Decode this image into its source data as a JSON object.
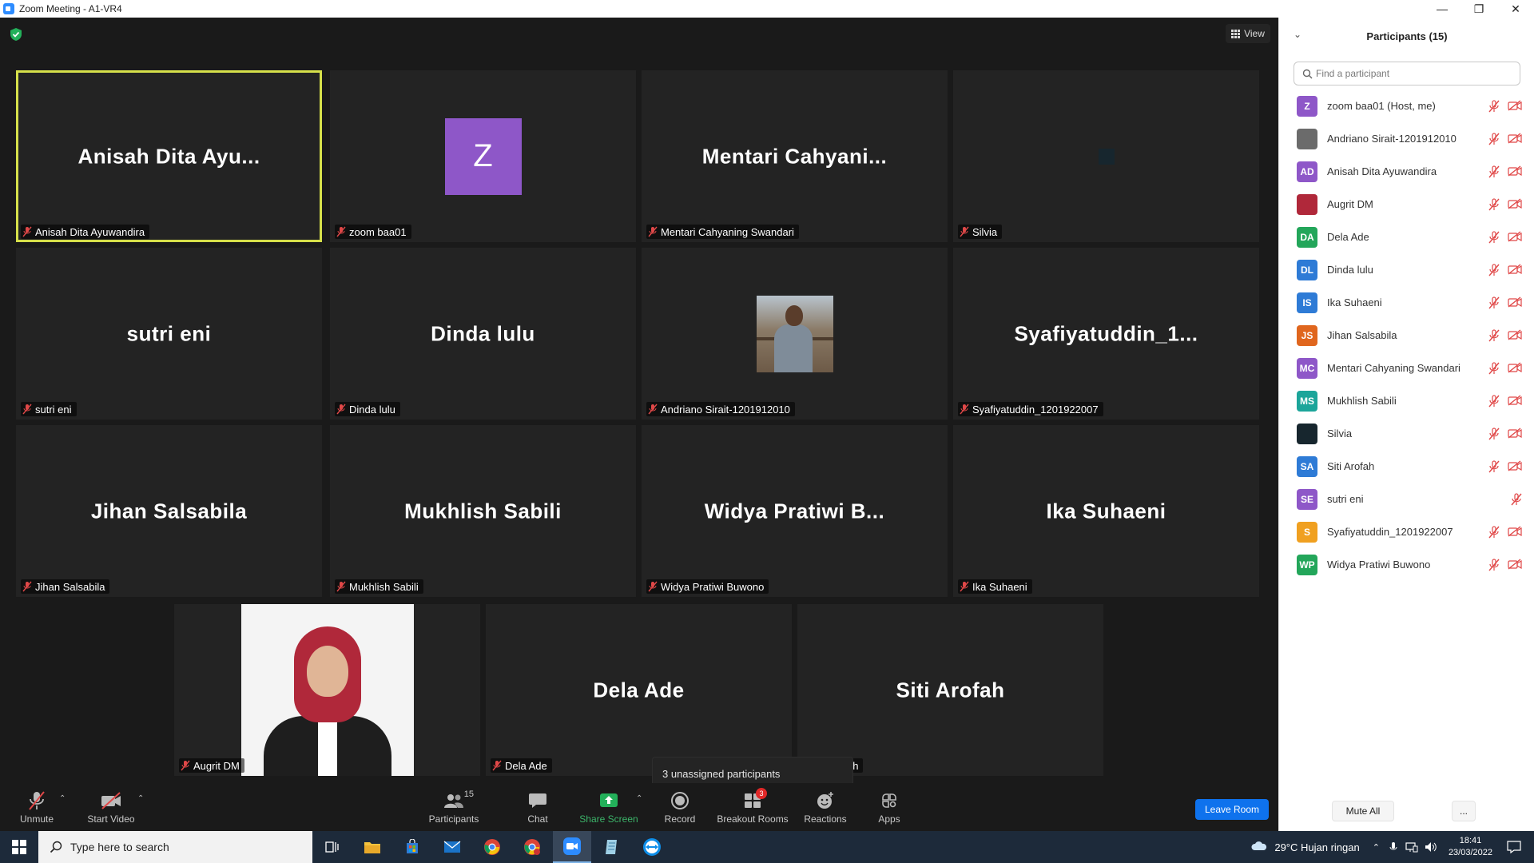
{
  "window": {
    "title": "Zoom Meeting - A1-VR4",
    "minimize": "—",
    "restore": "❐",
    "close": "✕"
  },
  "meeting": {
    "view_label": "View",
    "tiles": [
      {
        "big": "Anisah  Dita  Ayu...",
        "tag": "Anisah Dita Ayuwandira"
      },
      {
        "big": "Z",
        "tag": "zoom baa01"
      },
      {
        "big": "Mentari  Cahyani...",
        "tag": "Mentari Cahyaning Swandari"
      },
      {
        "big": "",
        "tag": "Silvia"
      },
      {
        "big": "sutri eni",
        "tag": "sutri eni"
      },
      {
        "big": "Dinda lulu",
        "tag": "Dinda lulu"
      },
      {
        "big": "",
        "tag": "Andriano Sirait-1201912010"
      },
      {
        "big": "Syafiyatuddin_1...",
        "tag": "Syafiyatuddin_1201922007"
      },
      {
        "big": "Jihan Salsabila",
        "tag": "Jihan Salsabila"
      },
      {
        "big": "Mukhlish Sabili",
        "tag": "Mukhlish Sabili"
      },
      {
        "big": "Widya  Pratiwi  B...",
        "tag": "Widya Pratiwi Buwono"
      },
      {
        "big": "Ika Suhaeni",
        "tag": "Ika Suhaeni"
      },
      {
        "big": "",
        "tag": "Augrit DM"
      },
      {
        "big": "Dela Ade",
        "tag": "Dela Ade"
      },
      {
        "big": "Siti Arofah",
        "tag": "ah"
      }
    ],
    "unassigned_tooltip": "3 unassigned participants"
  },
  "toolbar": {
    "unmute": "Unmute",
    "start_video": "Start Video",
    "participants": "Participants",
    "participants_count": "15",
    "chat": "Chat",
    "share_screen": "Share Screen",
    "record": "Record",
    "breakout_rooms": "Breakout Rooms",
    "breakout_badge": "3",
    "reactions": "Reactions",
    "apps": "Apps",
    "leave_room": "Leave Room"
  },
  "panel": {
    "title": "Participants (15)",
    "search_placeholder": "Find a participant",
    "participants": [
      {
        "initials": "Z",
        "name": "zoom baa01 (Host, me)",
        "color": "#8e57c8"
      },
      {
        "initials": "",
        "name": "Andriano Sirait-1201912010",
        "color": "#6b6b6b"
      },
      {
        "initials": "AD",
        "name": "Anisah Dita Ayuwandira",
        "color": "#8e57c8"
      },
      {
        "initials": "",
        "name": "Augrit DM",
        "color": "#b0283a"
      },
      {
        "initials": "DA",
        "name": "Dela Ade",
        "color": "#23a65a"
      },
      {
        "initials": "DL",
        "name": "Dinda lulu",
        "color": "#2e7bd6"
      },
      {
        "initials": "IS",
        "name": "Ika Suhaeni",
        "color": "#2e7bd6"
      },
      {
        "initials": "JS",
        "name": "Jihan Salsabila",
        "color": "#e0661e"
      },
      {
        "initials": "MC",
        "name": "Mentari Cahyaning Swandari",
        "color": "#8e57c8"
      },
      {
        "initials": "MS",
        "name": "Mukhlish Sabili",
        "color": "#1ca59a"
      },
      {
        "initials": "",
        "name": "Silvia",
        "color": "#17262e"
      },
      {
        "initials": "SA",
        "name": "Siti Arofah",
        "color": "#2e7bd6"
      },
      {
        "initials": "SE",
        "name": "sutri eni",
        "color": "#8e57c8"
      },
      {
        "initials": "S",
        "name": "Syafiyatuddin_1201922007",
        "color": "#f0a020"
      },
      {
        "initials": "WP",
        "name": "Widya Pratiwi Buwono",
        "color": "#23a65a"
      }
    ],
    "mute_all": "Mute All",
    "more": "..."
  },
  "taskbar": {
    "search_text": "Type here to search",
    "weather": "29°C  Hujan ringan",
    "time": "18:41",
    "date": "23/03/2022"
  }
}
